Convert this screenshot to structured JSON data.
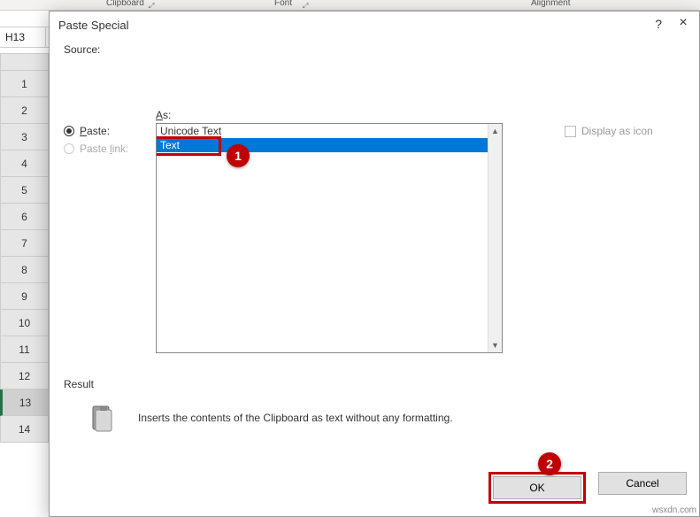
{
  "ribbon": {
    "group1": "Clipboard",
    "group2": "Font",
    "group3": "Alignment"
  },
  "namebox": {
    "value": "H13"
  },
  "rows": [
    "1",
    "2",
    "3",
    "4",
    "5",
    "6",
    "7",
    "8",
    "9",
    "10",
    "11",
    "12",
    "13",
    "14"
  ],
  "selectedRow": "13",
  "dialog": {
    "title": "Paste Special",
    "help_tooltip": "?",
    "close_tooltip": "×",
    "source_label": "Source:",
    "as_label": "As:",
    "paste_label": "Paste:",
    "paste_link_label": "Paste link:",
    "paste_hotkey": "P",
    "link_hotkey": "l",
    "as_hotkey": "A",
    "list": {
      "items": [
        "Unicode Text",
        "Text"
      ],
      "selected": "Text"
    },
    "display_as_icon": "Display as icon",
    "result_label": "Result",
    "result_text": "Inserts the contents of the Clipboard as text without any formatting.",
    "ok": "OK",
    "cancel": "Cancel"
  },
  "callouts": {
    "one": "1",
    "two": "2"
  },
  "watermark": "wsxdn.com"
}
